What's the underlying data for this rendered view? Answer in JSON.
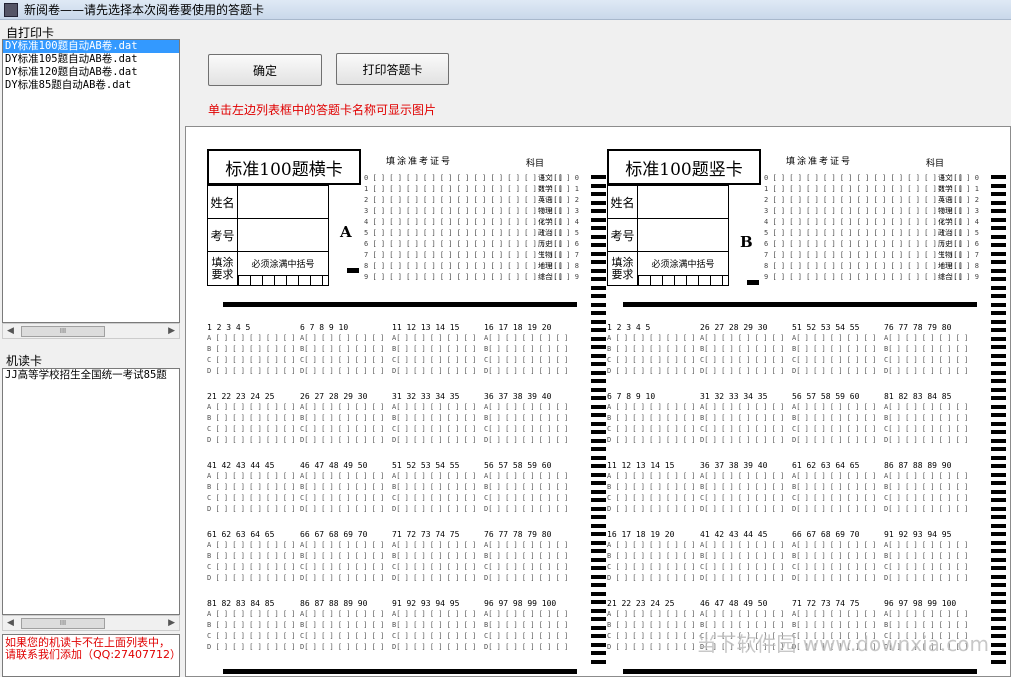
{
  "window": {
    "title": "新阅卷——请先选择本次阅卷要使用的答题卡"
  },
  "self_print": {
    "label": "自打印卡",
    "items": [
      "DY标准100题自动AB卷.dat",
      "DY标准105题自动AB卷.dat",
      "DY标准120题自动AB卷.dat",
      "DY标准85题自动AB卷.dat"
    ],
    "selected_index": 0
  },
  "machine_card": {
    "label": "机读卡",
    "items": [
      "JJ高等学校招生全国统一考试85题"
    ]
  },
  "note": "如果您的机读卡不在上面列表中，请联系我们添加（QQ:27407712）",
  "buttons": {
    "confirm": "确定",
    "print": "打印答题卡"
  },
  "hint": "单击左边列表框中的答题卡名称可显示图片",
  "preview": {
    "cards": [
      {
        "title": "标准100题横卡",
        "ab": "A",
        "blocks": [
          [
            "1 2 3 4 5",
            "6 7 8 9 10",
            "11 12 13 14 15",
            "16 17 18 19 20"
          ],
          [
            "21 22 23 24 25",
            "26 27 28 29 30",
            "31 32 33 34 35",
            "36 37 38 39 40"
          ],
          [
            "41 42 43 44 45",
            "46 47 48 49 50",
            "51 52 53 54 55",
            "56 57 58 59 60"
          ],
          [
            "61 62 63 64 65",
            "66 67 68 69 70",
            "71 72 73 74 75",
            "76 77 78 79 80"
          ],
          [
            "81 82 83 84 85",
            "86 87 88 89 90",
            "91 92 93 94 95",
            "96 97 98 99 100"
          ]
        ]
      },
      {
        "title": "标准100题竖卡",
        "ab": "B",
        "blocks": [
          [
            "1 2 3 4 5",
            "26 27 28 29 30",
            "51 52 53 54 55",
            "76 77 78 79 80"
          ],
          [
            "6 7 8 9 10",
            "31 32 33 34 35",
            "56 57 58 59 60",
            "81 82 83 84 85"
          ],
          [
            "11 12 13 14 15",
            "36 37 38 39 40",
            "61 62 63 64 65",
            "86 87 88 89 90"
          ],
          [
            "16 17 18 19 20",
            "41 42 43 44 45",
            "66 67 68 69 70",
            "91 92 93 94 95"
          ],
          [
            "21 22 23 24 25",
            "46 47 48 49 50",
            "71 72 73 74 75",
            "96 97 98 99 100"
          ]
        ]
      }
    ],
    "labels": {
      "name": "姓名",
      "exam_no": "考号",
      "fill_req_1": "填涂",
      "fill_req_2": "要求",
      "fill_note": "必须涂满中括号",
      "zkzh": "填涂准考证号",
      "subject": "科目"
    },
    "subjects": [
      "语文",
      "数学",
      "英语",
      "物理",
      "化学",
      "政治",
      "历史",
      "生物",
      "地理",
      "综合"
    ],
    "digits": [
      "0",
      "1",
      "2",
      "3",
      "4",
      "5",
      "6",
      "7",
      "8",
      "9"
    ],
    "options": [
      "A",
      "B",
      "C",
      "D"
    ]
  },
  "watermark": "当下软件园 www.downxia.com"
}
